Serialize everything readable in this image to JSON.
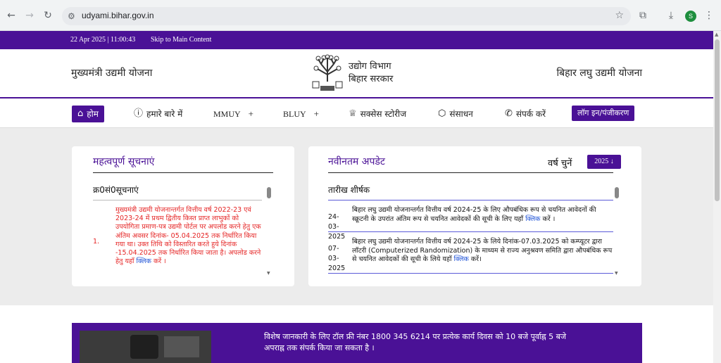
{
  "browser": {
    "url": "udyami.bihar.gov.in",
    "profile_initial": "S"
  },
  "topbar": {
    "datetime": "22 Apr 2025 | 11:00:43",
    "skip_link": "Skip to Main Content"
  },
  "header": {
    "left_title": "मुख्यमंत्री उद्यमी योजना",
    "dept_line1": "उद्योग विभाग",
    "dept_line2": "बिहार सरकार",
    "right_title": "बिहार लघु उद्यमी योजना"
  },
  "nav": {
    "home": "होम",
    "about": "हमारे बारे में",
    "mmuy": "MMUY",
    "bluy": "BLUY",
    "success": "सक्सेस स्टोरीज",
    "resources": "संसाधन",
    "contact": "संपर्क करें",
    "login": "लॉग इन/पंजीकरण"
  },
  "notices": {
    "title": "महत्वपूर्ण सूचनाएं",
    "col_no": "क्र0सं0",
    "col_title": "सूचनाएं",
    "items": [
      {
        "no": "1.",
        "text": "मुख्यमंत्री उद्यमी योजनान्तर्गत वित्तीय वर्ष 2022-23 एवं 2023-24 में प्रथम द्वितीय किस्त प्राप्त लाभुकों को उपयोगिता प्रमाण-पत्र उद्यमी पोर्टल पर अपलोड करने हेतु एक अंतिम अवसर दिनांक- 05.04.2025 तक निर्धारित किया गया था। उक्त तिथि को विस्तारित करते हुये दिनांक -15.04.2025 तक निर्धारित किया जाता है। अपलोड करने हेतु यहाँ",
        "link": "क्लिक",
        "suffix": "करें ।"
      }
    ]
  },
  "updates": {
    "title": "नवीनतम अपडेट",
    "year_label": "वर्ष चुनें",
    "year_value": "2025 ↓",
    "col_date": "तारीख",
    "col_title": "शीर्षक",
    "items": [
      {
        "date": "24-03-2025",
        "text": "बिहार लघु उद्यमी योजनान्तर्गत वित्तीय वर्ष 2024-25 के लिए औपबंधिक रूप से चयनित आवेदनों की स्क्रूटनी के उपरांत अंतिम रूप से चयनित आवेदकों की सूची के लिए यहाँ",
        "link": "क्लिक",
        "suffix": "करें ।"
      },
      {
        "date": "07-03-2025",
        "text": "बिहार लघु उद्यमी योजनान्तर्गत वित्तीय वर्ष 2024-25 के लिये दिनांक-07.03.2025 को कम्प्यूटर द्वारा लॉटरी (Computerized Randomization) के माध्यम से राज्य अनुश्रवण समिति द्वारा औपबंधिक रूप से चयनित आवेदकों की सूची के लिये यहाँ",
        "link": "क्लिक",
        "suffix": "करें।"
      }
    ]
  },
  "banner": {
    "text": "विशेष जानकारी के लिए टॉल फ्री नंबर 1800 345 6214 पर प्रत्येक कार्य दिवस को 10 बजे पूर्वाह्न 5 बजे अपराह्न तक संपर्क किया जा सकता है ।"
  }
}
